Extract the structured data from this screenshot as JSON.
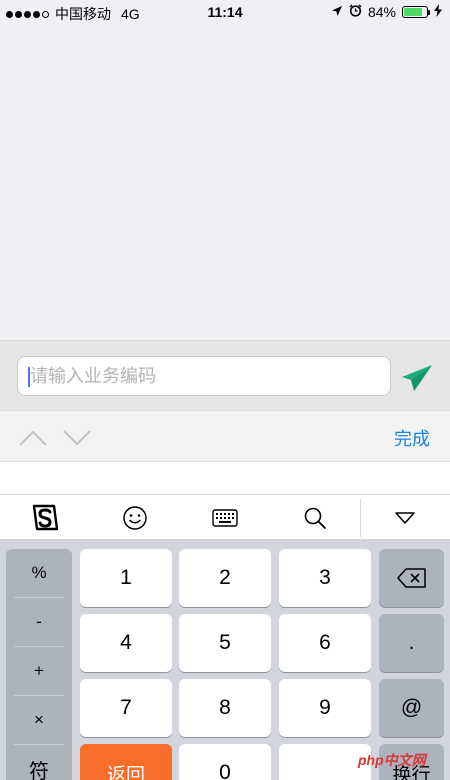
{
  "status_bar": {
    "carrier": "中国移动",
    "network": "4G",
    "time": "11:14",
    "battery_percent": "84%",
    "battery_level": 0.84
  },
  "input": {
    "placeholder": "请输入业务编码",
    "value": ""
  },
  "toolbar": {
    "done_label": "完成"
  },
  "ime": {
    "items": [
      "sogou-logo",
      "emoji",
      "keyboard",
      "search",
      "collapse"
    ]
  },
  "keyboard": {
    "symbols": [
      "%",
      "-",
      "+",
      "×",
      "符"
    ],
    "digits": [
      "1",
      "2",
      "3",
      "4",
      "5",
      "6",
      "7",
      "8",
      "9",
      "0"
    ],
    "back_label": "返回",
    "dot_label": ".",
    "at_label": "@",
    "newline_label": "换行"
  },
  "watermark": "php中文网",
  "colors": {
    "accent_blue": "#1a82e2",
    "send_green": "#1aad7c",
    "orange_key": "#f86d2a",
    "battery_green": "#4cd964"
  }
}
